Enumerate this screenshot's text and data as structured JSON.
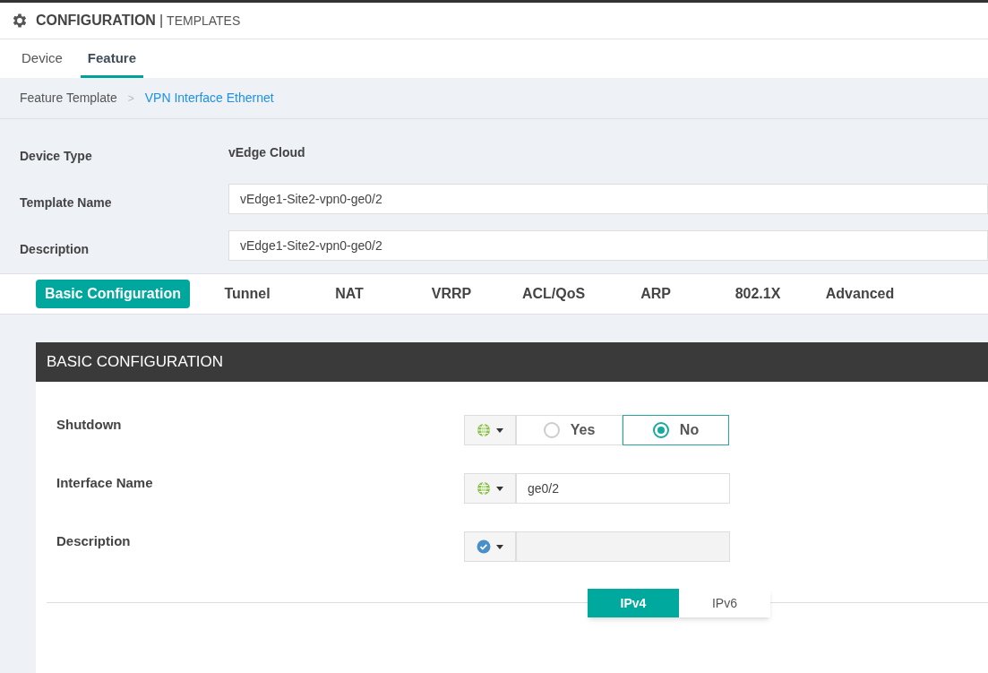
{
  "header": {
    "title": "CONFIGURATION",
    "separator": "|",
    "subtitle": "TEMPLATES"
  },
  "tabs": [
    {
      "label": "Device",
      "selected": false
    },
    {
      "label": "Feature",
      "selected": true
    }
  ],
  "breadcrumb": [
    {
      "label": "Feature Template",
      "kind": "text"
    },
    {
      "label": ">",
      "kind": "separator"
    },
    {
      "label": "VPN Interface Ethernet",
      "kind": "link"
    }
  ],
  "form": [
    {
      "label": "Device Type",
      "kind": "static",
      "value": "vEdge Cloud"
    },
    {
      "label": "Template Name",
      "kind": "input",
      "value": "vEdge1-Site2-vpn0-ge0/2"
    },
    {
      "label": "Description",
      "kind": "input",
      "value": "vEdge1-Site2-vpn0-ge0/2"
    }
  ],
  "section_tabs": [
    {
      "label": "Basic Configuration",
      "selected": true
    },
    {
      "label": "Tunnel",
      "selected": false
    },
    {
      "label": "NAT",
      "selected": false
    },
    {
      "label": "VRRP",
      "selected": false
    },
    {
      "label": "ACL/QoS",
      "selected": false
    },
    {
      "label": "ARP",
      "selected": false
    },
    {
      "label": "802.1X",
      "selected": false
    },
    {
      "label": "Advanced",
      "selected": false
    }
  ],
  "panel": {
    "title": "BASIC CONFIGURATION",
    "fields": [
      {
        "label": "Shutdown",
        "scope": {
          "kind": "global"
        },
        "kind": "radio",
        "options": [
          {
            "label": "Yes",
            "selected": false
          },
          {
            "label": "No",
            "selected": true
          }
        ]
      },
      {
        "label": "Interface Name",
        "scope": {
          "kind": "global"
        },
        "kind": "text",
        "value": "ge0/2",
        "disabled": false
      },
      {
        "label": "Description",
        "scope": {
          "kind": "default"
        },
        "kind": "text",
        "disabled": true
      }
    ],
    "ip_tabs": [
      {
        "label": "IPv4",
        "selected": true
      },
      {
        "label": "IPv6",
        "selected": false
      }
    ]
  }
}
